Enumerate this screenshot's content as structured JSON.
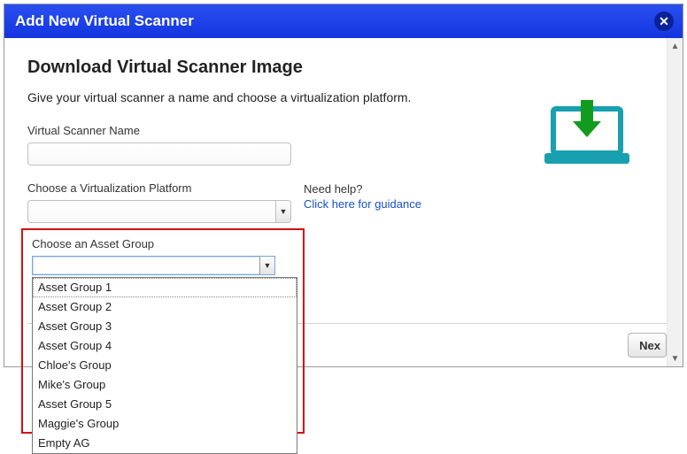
{
  "titlebar": {
    "title": "Add New Virtual Scanner"
  },
  "page": {
    "heading": "Download Virtual Scanner Image",
    "subtitle": "Give your virtual scanner a name and choose a virtualization platform."
  },
  "fields": {
    "name_label": "Virtual Scanner Name",
    "name_value": "",
    "platform_label": "Choose a Virtualization Platform",
    "platform_value": "",
    "asset_label": "Choose an Asset Group",
    "asset_value": ""
  },
  "help": {
    "prompt": "Need help?",
    "link": "Click here for guidance"
  },
  "buttons": {
    "next": "Nex"
  },
  "asset_options": [
    "Asset Group 1",
    "Asset Group 2",
    "Asset Group 3",
    "Asset Group 4",
    "Chloe's Group",
    "Mike's Group",
    "Asset Group 5",
    "Maggie's Group",
    "Empty AG"
  ],
  "colors": {
    "accent": "#18a0b0",
    "arrow": "#139b1e"
  }
}
